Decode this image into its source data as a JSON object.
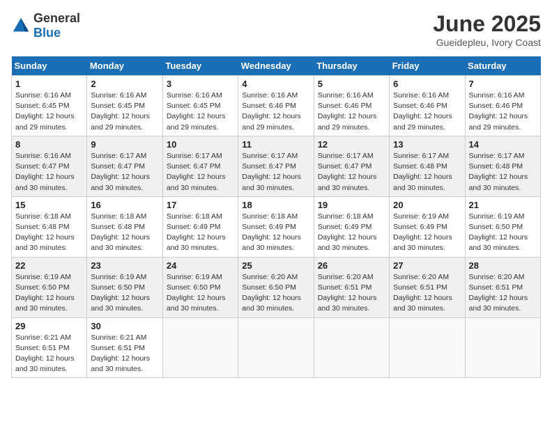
{
  "logo": {
    "general": "General",
    "blue": "Blue"
  },
  "title": "June 2025",
  "subtitle": "Gueidepleu, Ivory Coast",
  "weekdays": [
    "Sunday",
    "Monday",
    "Tuesday",
    "Wednesday",
    "Thursday",
    "Friday",
    "Saturday"
  ],
  "weeks": [
    [
      {
        "day": "1",
        "sunrise": "6:16 AM",
        "sunset": "6:45 PM",
        "daylight": "12 hours and 29 minutes."
      },
      {
        "day": "2",
        "sunrise": "6:16 AM",
        "sunset": "6:45 PM",
        "daylight": "12 hours and 29 minutes."
      },
      {
        "day": "3",
        "sunrise": "6:16 AM",
        "sunset": "6:45 PM",
        "daylight": "12 hours and 29 minutes."
      },
      {
        "day": "4",
        "sunrise": "6:16 AM",
        "sunset": "6:46 PM",
        "daylight": "12 hours and 29 minutes."
      },
      {
        "day": "5",
        "sunrise": "6:16 AM",
        "sunset": "6:46 PM",
        "daylight": "12 hours and 29 minutes."
      },
      {
        "day": "6",
        "sunrise": "6:16 AM",
        "sunset": "6:46 PM",
        "daylight": "12 hours and 29 minutes."
      },
      {
        "day": "7",
        "sunrise": "6:16 AM",
        "sunset": "6:46 PM",
        "daylight": "12 hours and 29 minutes."
      }
    ],
    [
      {
        "day": "8",
        "sunrise": "6:16 AM",
        "sunset": "6:47 PM",
        "daylight": "12 hours and 30 minutes."
      },
      {
        "day": "9",
        "sunrise": "6:17 AM",
        "sunset": "6:47 PM",
        "daylight": "12 hours and 30 minutes."
      },
      {
        "day": "10",
        "sunrise": "6:17 AM",
        "sunset": "6:47 PM",
        "daylight": "12 hours and 30 minutes."
      },
      {
        "day": "11",
        "sunrise": "6:17 AM",
        "sunset": "6:47 PM",
        "daylight": "12 hours and 30 minutes."
      },
      {
        "day": "12",
        "sunrise": "6:17 AM",
        "sunset": "6:47 PM",
        "daylight": "12 hours and 30 minutes."
      },
      {
        "day": "13",
        "sunrise": "6:17 AM",
        "sunset": "6:48 PM",
        "daylight": "12 hours and 30 minutes."
      },
      {
        "day": "14",
        "sunrise": "6:17 AM",
        "sunset": "6:48 PM",
        "daylight": "12 hours and 30 minutes."
      }
    ],
    [
      {
        "day": "15",
        "sunrise": "6:18 AM",
        "sunset": "6:48 PM",
        "daylight": "12 hours and 30 minutes."
      },
      {
        "day": "16",
        "sunrise": "6:18 AM",
        "sunset": "6:48 PM",
        "daylight": "12 hours and 30 minutes."
      },
      {
        "day": "17",
        "sunrise": "6:18 AM",
        "sunset": "6:49 PM",
        "daylight": "12 hours and 30 minutes."
      },
      {
        "day": "18",
        "sunrise": "6:18 AM",
        "sunset": "6:49 PM",
        "daylight": "12 hours and 30 minutes."
      },
      {
        "day": "19",
        "sunrise": "6:18 AM",
        "sunset": "6:49 PM",
        "daylight": "12 hours and 30 minutes."
      },
      {
        "day": "20",
        "sunrise": "6:19 AM",
        "sunset": "6:49 PM",
        "daylight": "12 hours and 30 minutes."
      },
      {
        "day": "21",
        "sunrise": "6:19 AM",
        "sunset": "6:50 PM",
        "daylight": "12 hours and 30 minutes."
      }
    ],
    [
      {
        "day": "22",
        "sunrise": "6:19 AM",
        "sunset": "6:50 PM",
        "daylight": "12 hours and 30 minutes."
      },
      {
        "day": "23",
        "sunrise": "6:19 AM",
        "sunset": "6:50 PM",
        "daylight": "12 hours and 30 minutes."
      },
      {
        "day": "24",
        "sunrise": "6:19 AM",
        "sunset": "6:50 PM",
        "daylight": "12 hours and 30 minutes."
      },
      {
        "day": "25",
        "sunrise": "6:20 AM",
        "sunset": "6:50 PM",
        "daylight": "12 hours and 30 minutes."
      },
      {
        "day": "26",
        "sunrise": "6:20 AM",
        "sunset": "6:51 PM",
        "daylight": "12 hours and 30 minutes."
      },
      {
        "day": "27",
        "sunrise": "6:20 AM",
        "sunset": "6:51 PM",
        "daylight": "12 hours and 30 minutes."
      },
      {
        "day": "28",
        "sunrise": "6:20 AM",
        "sunset": "6:51 PM",
        "daylight": "12 hours and 30 minutes."
      }
    ],
    [
      {
        "day": "29",
        "sunrise": "6:21 AM",
        "sunset": "6:51 PM",
        "daylight": "12 hours and 30 minutes."
      },
      {
        "day": "30",
        "sunrise": "6:21 AM",
        "sunset": "6:51 PM",
        "daylight": "12 hours and 30 minutes."
      },
      null,
      null,
      null,
      null,
      null
    ]
  ]
}
